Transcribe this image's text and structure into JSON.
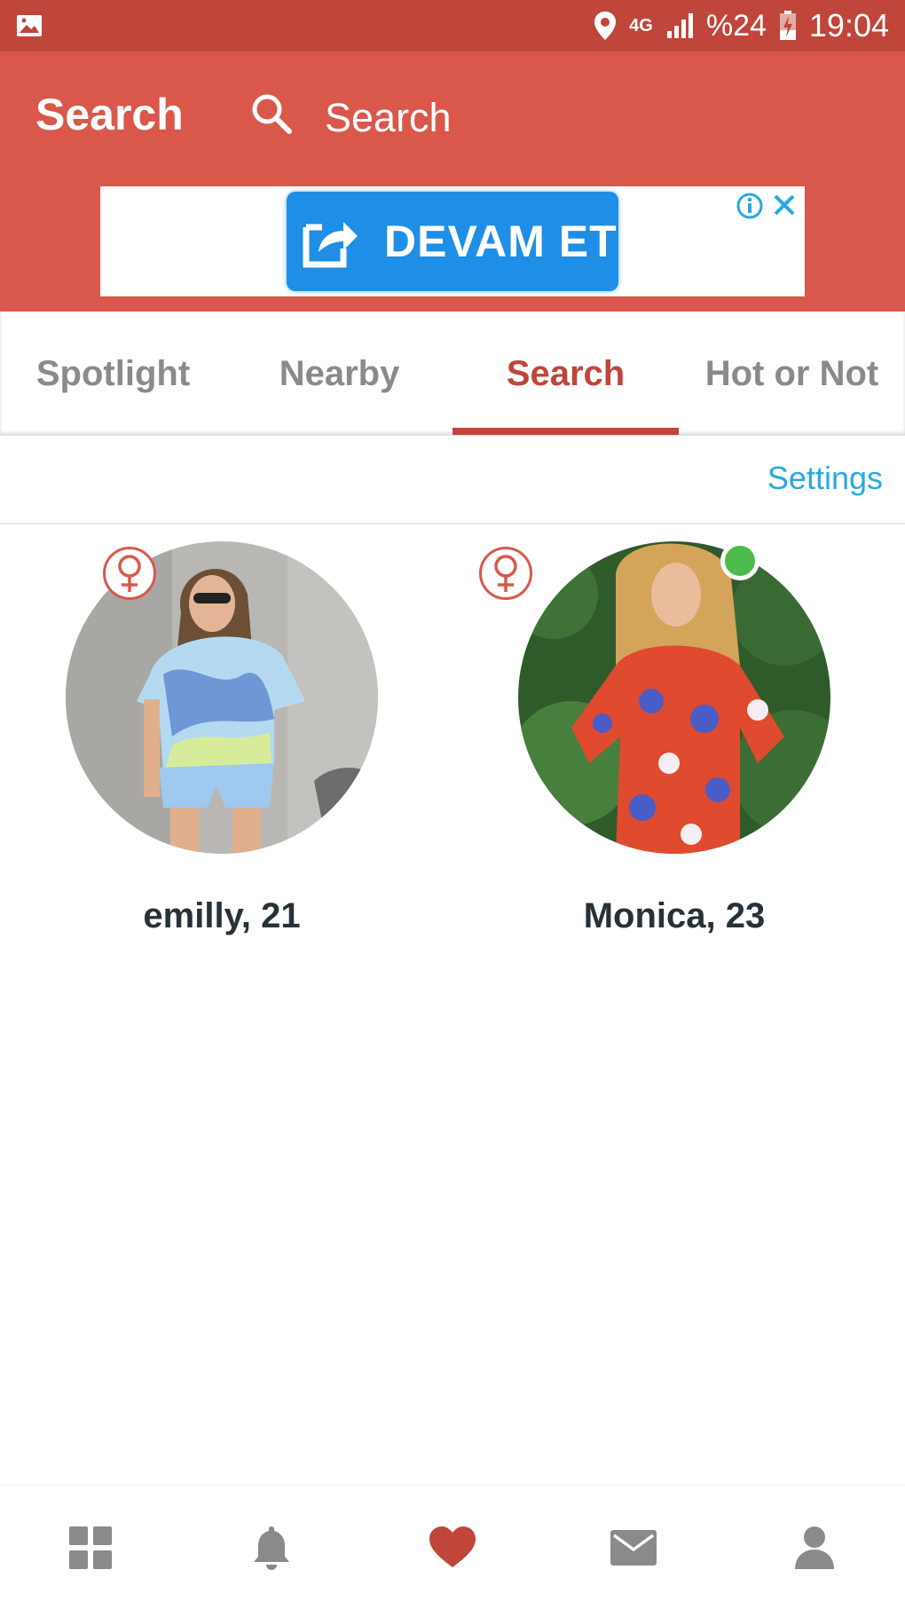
{
  "status_bar": {
    "network": "4G",
    "battery": "%24",
    "time": "19:04"
  },
  "header": {
    "title": "Search",
    "search_placeholder": "Search"
  },
  "ad": {
    "button_label": "DEVAM ET"
  },
  "tabs": [
    {
      "label": "Spotlight",
      "active": false
    },
    {
      "label": "Nearby",
      "active": false
    },
    {
      "label": "Search",
      "active": true
    },
    {
      "label": "Hot or Not",
      "active": false
    }
  ],
  "settings_label": "Settings",
  "profiles": [
    {
      "name": "emilly, 21",
      "gender": "female",
      "online": false
    },
    {
      "name": "Monica, 23",
      "gender": "female",
      "online": true
    }
  ],
  "bottom_nav": [
    {
      "icon": "grid-icon",
      "active": false
    },
    {
      "icon": "bell-icon",
      "active": false
    },
    {
      "icon": "heart-icon",
      "active": true
    },
    {
      "icon": "mail-icon",
      "active": false
    },
    {
      "icon": "person-icon",
      "active": false
    }
  ],
  "colors": {
    "status_bar": "#c0453a",
    "app_bar": "#d9584b",
    "accent": "#c0453a",
    "ad_button": "#1e8ee6",
    "settings_link": "#29a8e0",
    "online": "#4cbb4c",
    "nav_inactive": "#8a8a8a"
  }
}
